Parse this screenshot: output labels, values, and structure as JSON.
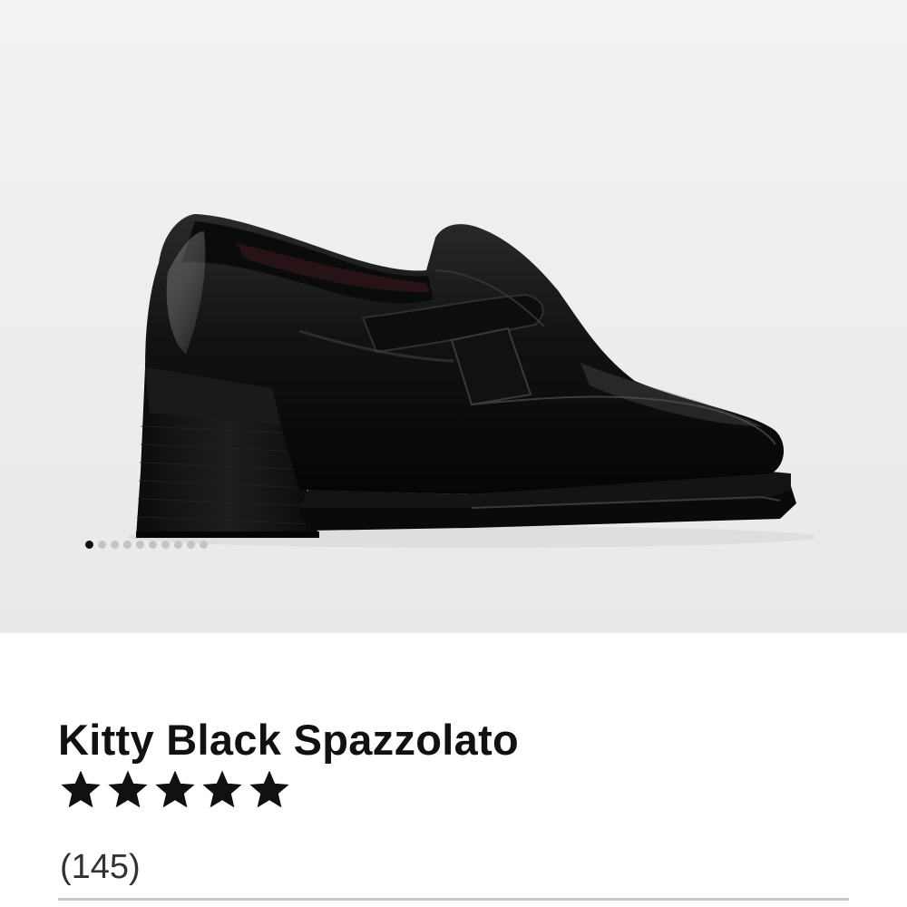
{
  "product": {
    "title": "Kitty Black Spazzolato",
    "rating": 5,
    "rating_max": 5,
    "review_count_text": "(145)"
  },
  "gallery": {
    "image_name": "black-loafer-heel-side-view",
    "image_count": 10,
    "active_index": 0
  },
  "colors": {
    "gallery_background": "#efefef",
    "text": "#111111",
    "dot_active": "#111111",
    "dot_inactive": "#c4c4c4",
    "divider": "#c8c8c8"
  }
}
